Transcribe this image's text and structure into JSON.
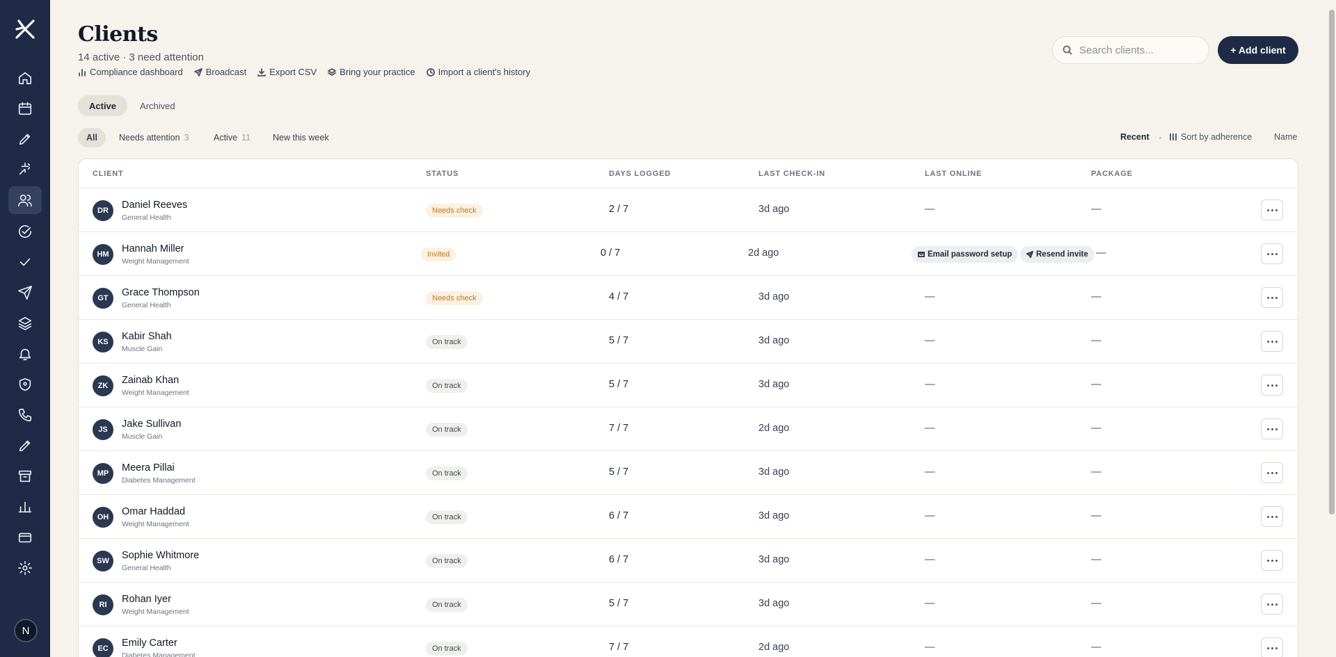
{
  "header": {
    "title": "Clients",
    "subtitle": "14 active · 3 need attention",
    "links": [
      "Compliance dashboard",
      "Broadcast",
      "Export CSV",
      "Bring your practice",
      "Import a client's history"
    ]
  },
  "search": {
    "placeholder": "Search clients..."
  },
  "add_button": "+ Add client",
  "tabs": [
    "Active",
    "Archived"
  ],
  "filters": [
    {
      "label": "All",
      "count": ""
    },
    {
      "label": "Needs attention",
      "count": "3"
    },
    {
      "label": "Active",
      "count": "11"
    },
    {
      "label": "New this week",
      "count": ""
    }
  ],
  "sort": {
    "recent": "Recent",
    "adherence": "Sort by adherence",
    "name": "Name"
  },
  "columns": [
    "CLIENT",
    "STATUS",
    "DAYS LOGGED",
    "LAST CHECK-IN",
    "LAST ONLINE",
    "PACKAGE"
  ],
  "invite_actions": {
    "email": "Email password setup",
    "resend": "Resend invite"
  },
  "rows": [
    {
      "initials": "DR",
      "name": "Daniel Reeves",
      "program": "General Health",
      "status": "Needs check",
      "days": "2 / 7",
      "checkin": "3d ago",
      "online": "—",
      "package": "—"
    },
    {
      "initials": "HM",
      "name": "Hannah Miller",
      "program": "Weight Management",
      "status": "Invited",
      "days": "0 / 7",
      "checkin": "2d ago",
      "online": "",
      "package": "—"
    },
    {
      "initials": "GT",
      "name": "Grace Thompson",
      "program": "General Health",
      "status": "Needs check",
      "days": "4 / 7",
      "checkin": "3d ago",
      "online": "—",
      "package": "—"
    },
    {
      "initials": "KS",
      "name": "Kabir Shah",
      "program": "Muscle Gain",
      "status": "On track",
      "days": "5 / 7",
      "checkin": "3d ago",
      "online": "—",
      "package": "—"
    },
    {
      "initials": "ZK",
      "name": "Zainab Khan",
      "program": "Weight Management",
      "status": "On track",
      "days": "5 / 7",
      "checkin": "3d ago",
      "online": "—",
      "package": "—"
    },
    {
      "initials": "JS",
      "name": "Jake Sullivan",
      "program": "Muscle Gain",
      "status": "On track",
      "days": "7 / 7",
      "checkin": "2d ago",
      "online": "—",
      "package": "—"
    },
    {
      "initials": "MP",
      "name": "Meera Pillai",
      "program": "Diabetes Management",
      "status": "On track",
      "days": "5 / 7",
      "checkin": "3d ago",
      "online": "—",
      "package": "—"
    },
    {
      "initials": "OH",
      "name": "Omar Haddad",
      "program": "Weight Management",
      "status": "On track",
      "days": "6 / 7",
      "checkin": "3d ago",
      "online": "—",
      "package": "—"
    },
    {
      "initials": "SW",
      "name": "Sophie Whitmore",
      "program": "General Health",
      "status": "On track",
      "days": "6 / 7",
      "checkin": "3d ago",
      "online": "—",
      "package": "—"
    },
    {
      "initials": "RI",
      "name": "Rohan Iyer",
      "program": "Weight Management",
      "status": "On track",
      "days": "5 / 7",
      "checkin": "3d ago",
      "online": "—",
      "package": "—"
    },
    {
      "initials": "EC",
      "name": "Emily Carter",
      "program": "Diabetes Management",
      "status": "On track",
      "days": "7 / 7",
      "checkin": "2d ago",
      "online": "—",
      "package": "—"
    }
  ],
  "user_avatar": "N",
  "sidebar_icons": [
    "home-icon",
    "calendar-icon",
    "pen-icon",
    "sparkle-icon",
    "users-icon",
    "check-circle-icon",
    "check-icon",
    "send-icon",
    "layers-icon",
    "bell-icon",
    "shield-icon",
    "phone-icon",
    "edit-icon",
    "archive-icon",
    "bar-chart-icon",
    "credit-card-icon",
    "gear-icon"
  ]
}
